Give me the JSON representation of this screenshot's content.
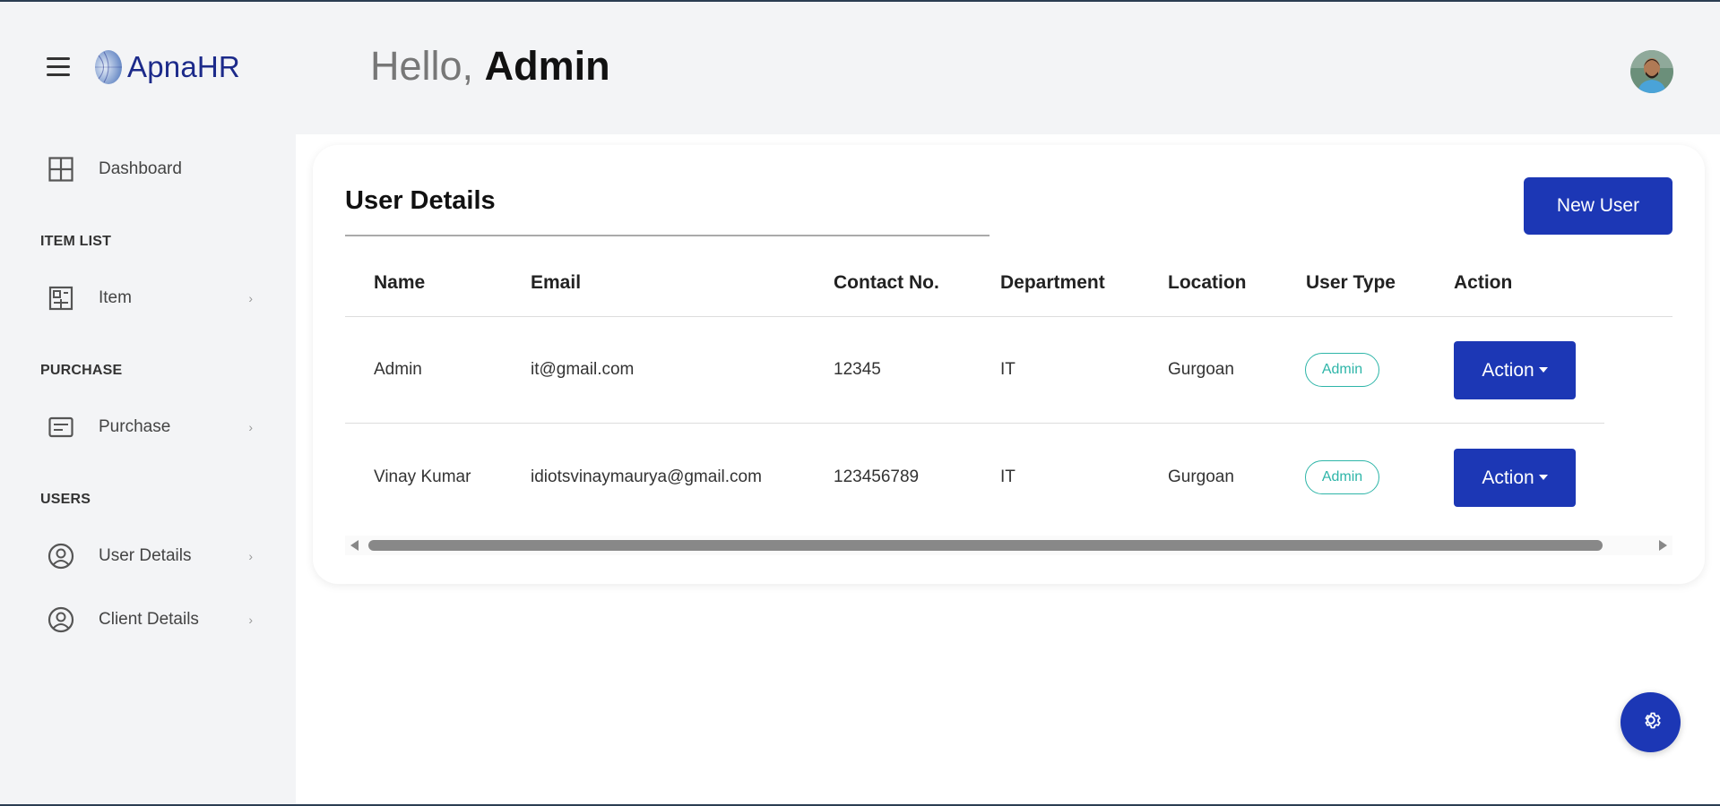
{
  "app": {
    "name": "ApnaHR"
  },
  "header": {
    "greeting_prefix": "Hello,",
    "user_name": "Admin"
  },
  "sidebar": {
    "dashboard": {
      "label": "Dashboard",
      "icon": "grid-icon"
    },
    "sections": [
      {
        "title": "ITEM LIST",
        "items": [
          {
            "label": "Item",
            "icon": "item-icon"
          }
        ]
      },
      {
        "title": "PURCHASE",
        "items": [
          {
            "label": "Purchase",
            "icon": "purchase-icon"
          }
        ]
      },
      {
        "title": "USERS",
        "items": [
          {
            "label": "User Details",
            "icon": "user-circle-icon"
          },
          {
            "label": "Client Details",
            "icon": "user-circle-icon"
          }
        ]
      }
    ]
  },
  "card": {
    "title": "User Details",
    "new_user_label": "New User",
    "columns": [
      "Name",
      "Email",
      "Contact No.",
      "Department",
      "Location",
      "User Type",
      "Action"
    ],
    "rows": [
      {
        "name": "Admin",
        "email": "it@gmail.com",
        "contact": "12345",
        "department": "IT",
        "location": "Gurgoan",
        "user_type": "Admin",
        "action": "Action"
      },
      {
        "name": "Vinay Kumar",
        "email": "idiotsvinaymaurya@gmail.com",
        "contact": "123456789",
        "department": "IT",
        "location": "Gurgoan",
        "user_type": "Admin",
        "action": "Action"
      }
    ]
  },
  "colors": {
    "primary": "#1c37b5",
    "badge": "#2eb5a8",
    "logo_text": "#1c2a8a"
  }
}
